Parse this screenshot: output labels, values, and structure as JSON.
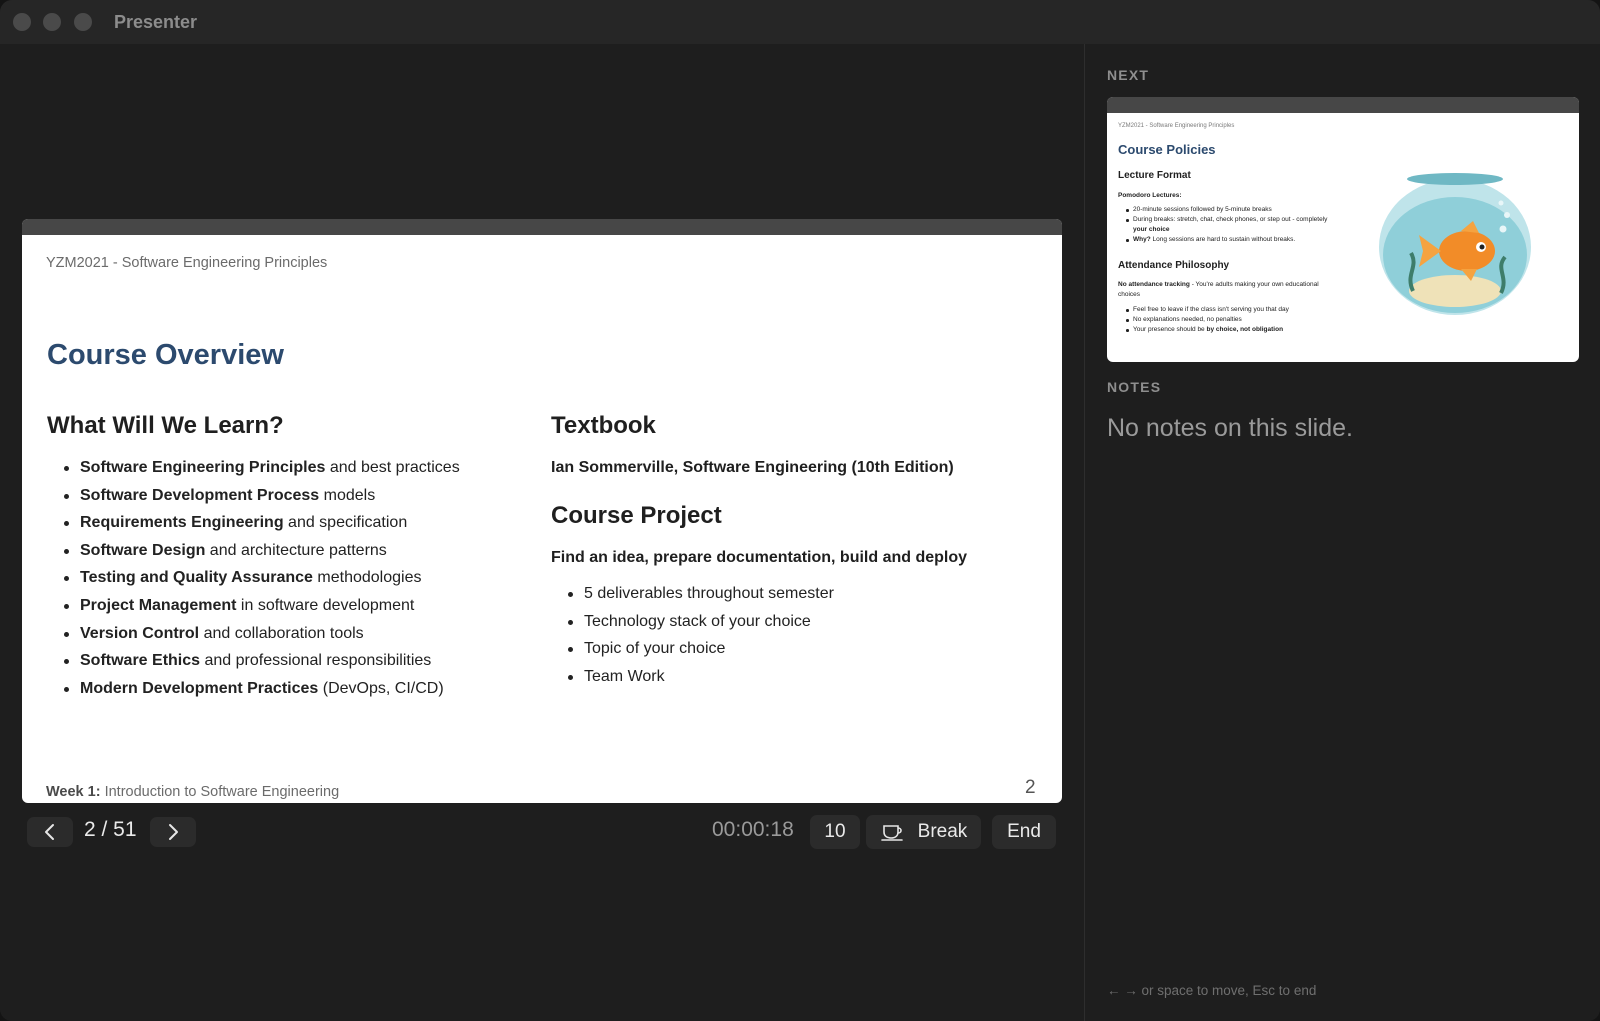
{
  "window": {
    "title": "Presenter"
  },
  "current_slide": {
    "header": "YZM2021 - Software Engineering Principles",
    "title": "Course Overview",
    "left": {
      "heading": "What Will We Learn?",
      "items": [
        {
          "bold": "Software Engineering Principles",
          "rest": " and best practices"
        },
        {
          "bold": "Software Development Process",
          "rest": " models"
        },
        {
          "bold": "Requirements Engineering",
          "rest": " and specification"
        },
        {
          "bold": "Software Design",
          "rest": " and architecture patterns"
        },
        {
          "bold": "Testing and Quality Assurance",
          "rest": " methodologies"
        },
        {
          "bold": "Project Management",
          "rest": " in software development"
        },
        {
          "bold": "Version Control",
          "rest": " and collaboration tools"
        },
        {
          "bold": "Software Ethics",
          "rest": " and professional responsibilities"
        },
        {
          "bold": "Modern Development Practices",
          "rest": " (DevOps, CI/CD)"
        }
      ]
    },
    "right": {
      "textbook_heading": "Textbook",
      "textbook_text": "Ian Sommerville, Software Engineering (10th Edition)",
      "project_heading": "Course Project",
      "project_intro": "Find an idea, prepare documentation, build and deploy",
      "project_items": [
        "5 deliverables throughout semester",
        "Technology stack of your choice",
        "Topic of your choice",
        "Team Work"
      ]
    },
    "footer_bold": "Week 1:",
    "footer_rest": " Introduction to Software Engineering",
    "page_number": "2"
  },
  "controls": {
    "counter": "2 / 51",
    "elapsed": "00:00:18",
    "break_minutes": "10",
    "break_label": "Break",
    "end_label": "End",
    "prev_icon": "chevron-left-icon",
    "next_icon": "chevron-right-icon",
    "break_icon": "coffee-cup-icon"
  },
  "side": {
    "next_label": "NEXT",
    "notes_label": "NOTES",
    "notes_text": "No notes on this slide.",
    "hint": "← → or space to move, Esc to end"
  },
  "next_slide": {
    "header": "YZM2021 - Software Engineering Principles",
    "title": "Course Policies",
    "section1": "Lecture Format",
    "pomodoro_label": "Pomodoro Lectures:",
    "pomodoro_items": [
      {
        "text": "20-minute sessions followed by 5-minute breaks",
        "bold": ""
      },
      {
        "text": "During breaks: stretch, chat, check phones, or step out - completely ",
        "bold": "your choice"
      },
      {
        "bold_lead": "Why?",
        "text": " Long sessions are hard to sustain without breaks."
      }
    ],
    "section2": "Attendance Philosophy",
    "attendance_bold": "No attendance tracking",
    "attendance_rest": " - You're adults making your own educational choices",
    "attendance_items": [
      {
        "text": "Feel free to leave if the class isn't serving you that day",
        "bold": ""
      },
      {
        "text": "No explanations needed, no penalties",
        "bold": ""
      },
      {
        "text": "Your presence should be ",
        "bold": "by choice, not obligation"
      }
    ],
    "image_icon": "goldfish-bowl-icon"
  },
  "colors": {
    "slide_title": "#2c4a6e",
    "background": "#1e1e1e"
  }
}
